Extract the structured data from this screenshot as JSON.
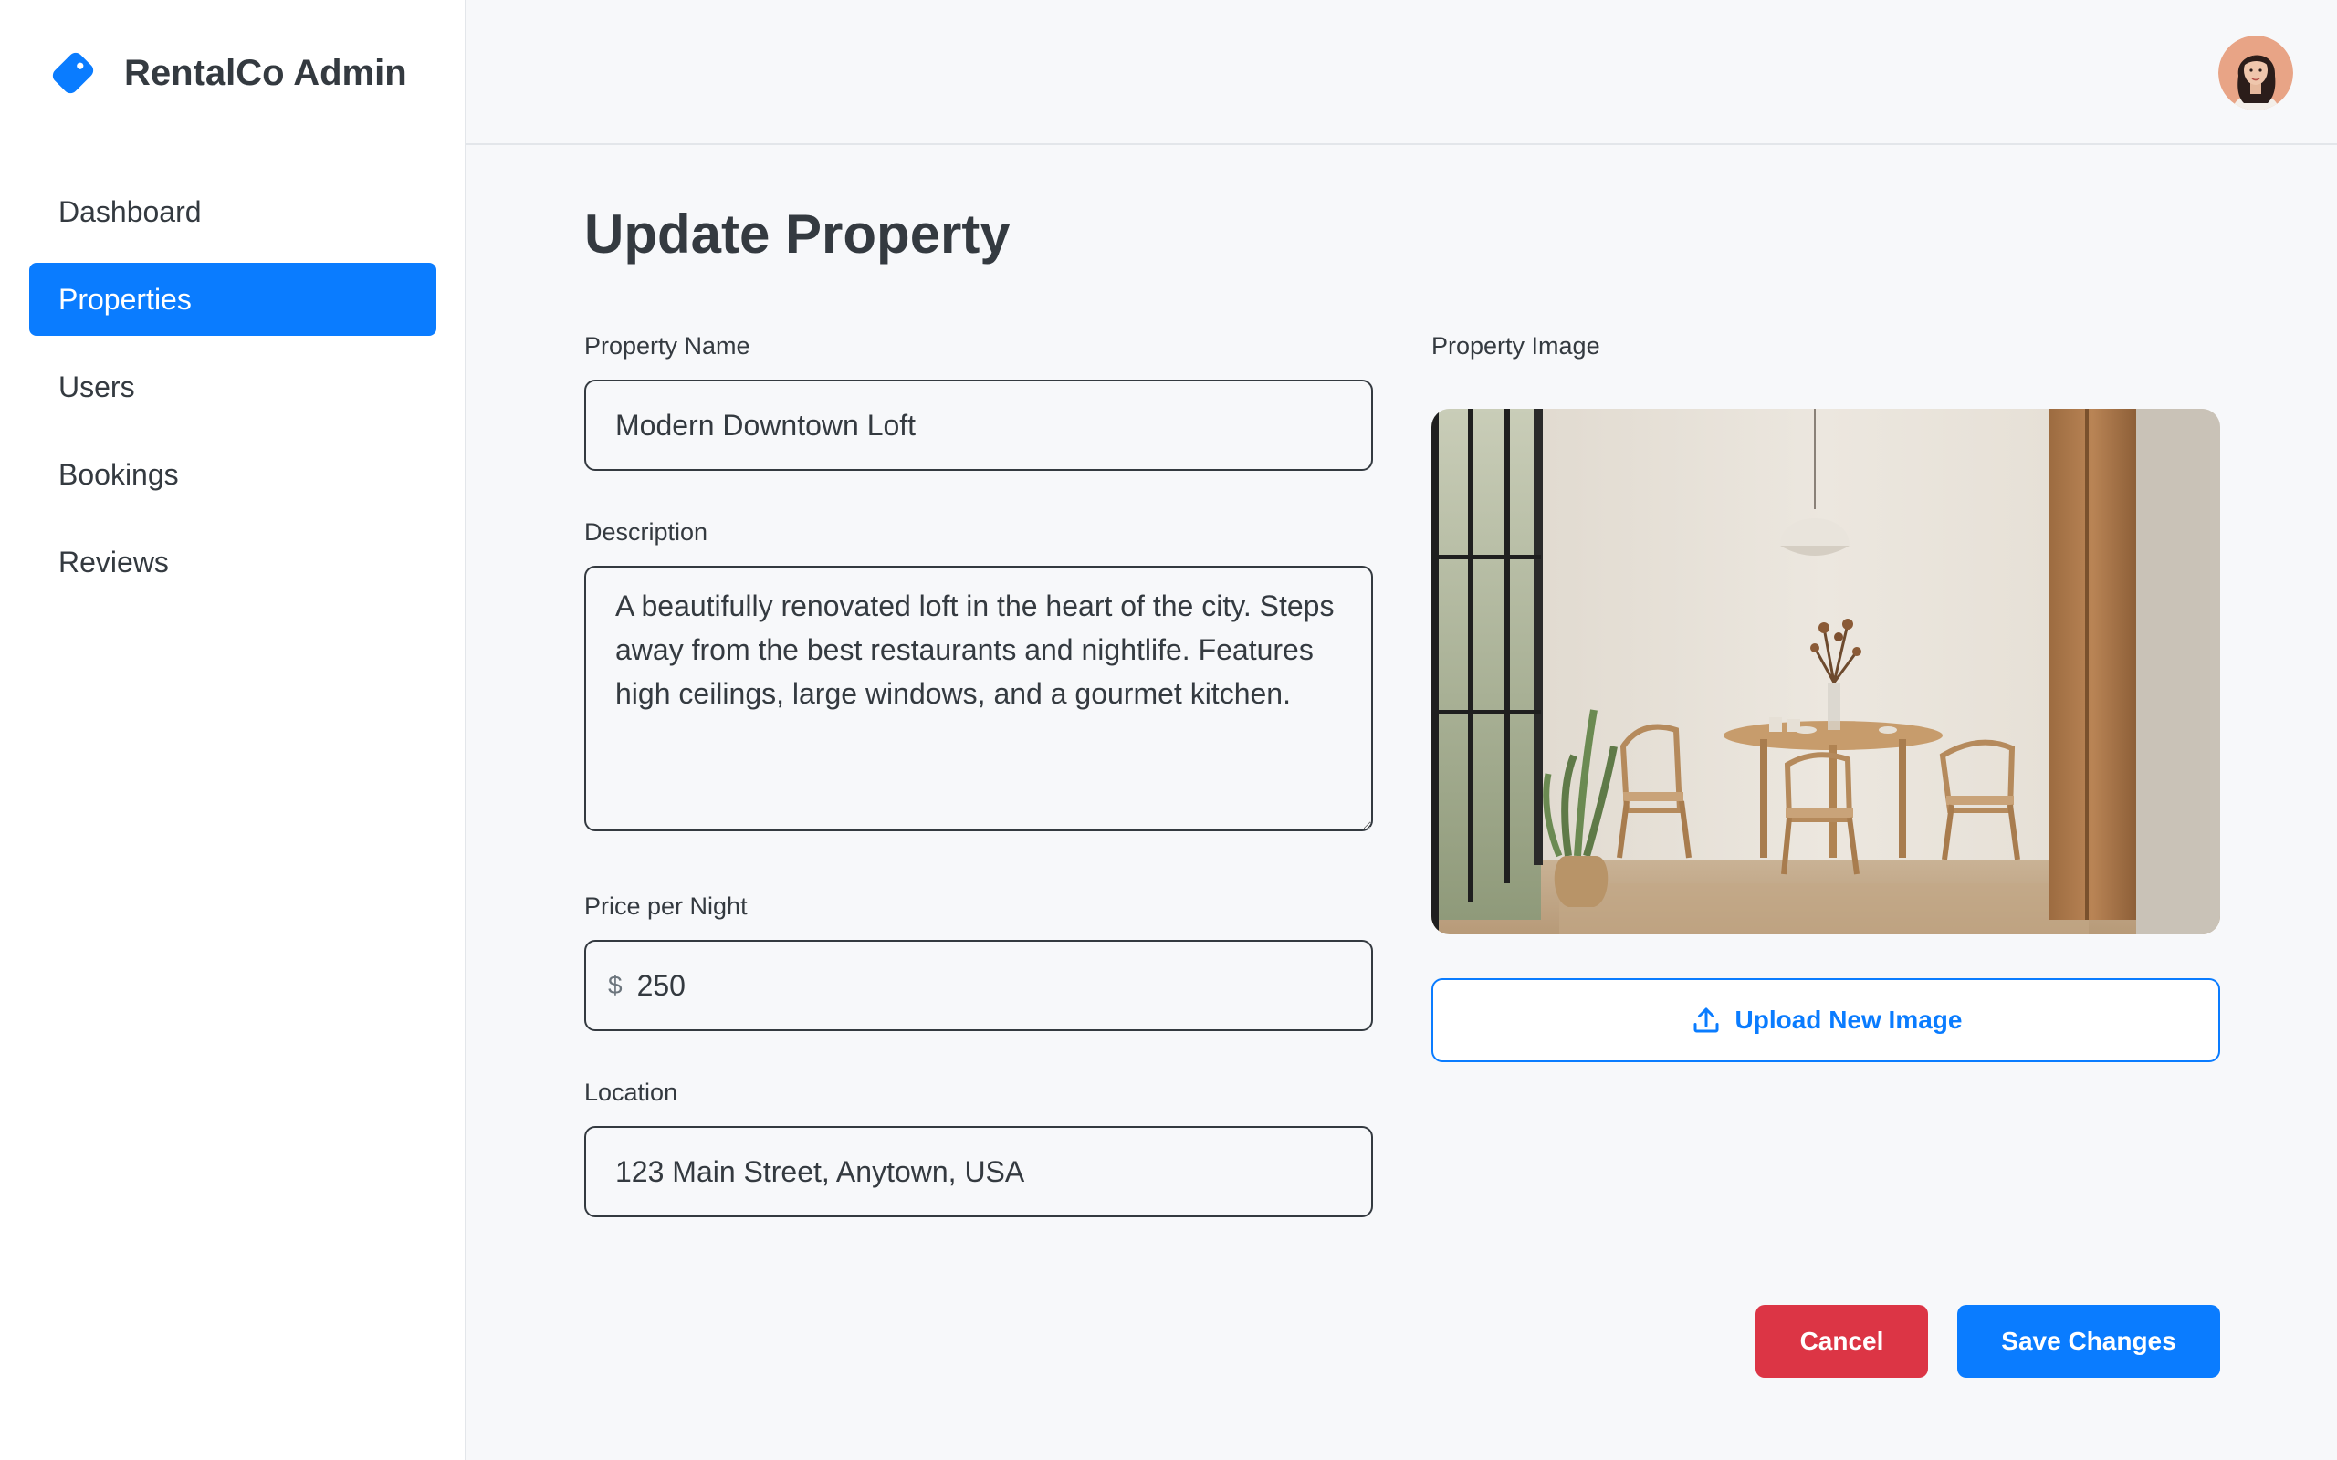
{
  "app": {
    "name": "RentalCo Admin",
    "brand_color": "#0a7cff",
    "logo_icon": "tag-icon"
  },
  "sidebar": {
    "items": [
      {
        "label": "Dashboard",
        "active": false
      },
      {
        "label": "Properties",
        "active": true
      },
      {
        "label": "Users",
        "active": false
      },
      {
        "label": "Bookings",
        "active": false
      },
      {
        "label": "Reviews",
        "active": false
      }
    ]
  },
  "header": {
    "avatar_icon": "user-avatar"
  },
  "form": {
    "title": "Update Property",
    "property_name": {
      "label": "Property Name",
      "value": "Modern Downtown Loft"
    },
    "description": {
      "label": "Description",
      "value": "A beautifully renovated loft in the heart of the city. Steps away from the best restaurants and nightlife. Features high ceilings, large windows, and a gourmet kitchen."
    },
    "price": {
      "label": "Price per Night",
      "currency_symbol": "$",
      "value": "250"
    },
    "location": {
      "label": "Location",
      "value": "123 Main Street, Anytown, USA"
    },
    "image": {
      "label": "Property Image",
      "upload_label": "Upload New Image",
      "upload_icon": "upload-icon"
    },
    "actions": {
      "cancel_label": "Cancel",
      "save_label": "Save Changes",
      "cancel_color": "#dc3545",
      "save_color": "#0a7cff"
    }
  }
}
